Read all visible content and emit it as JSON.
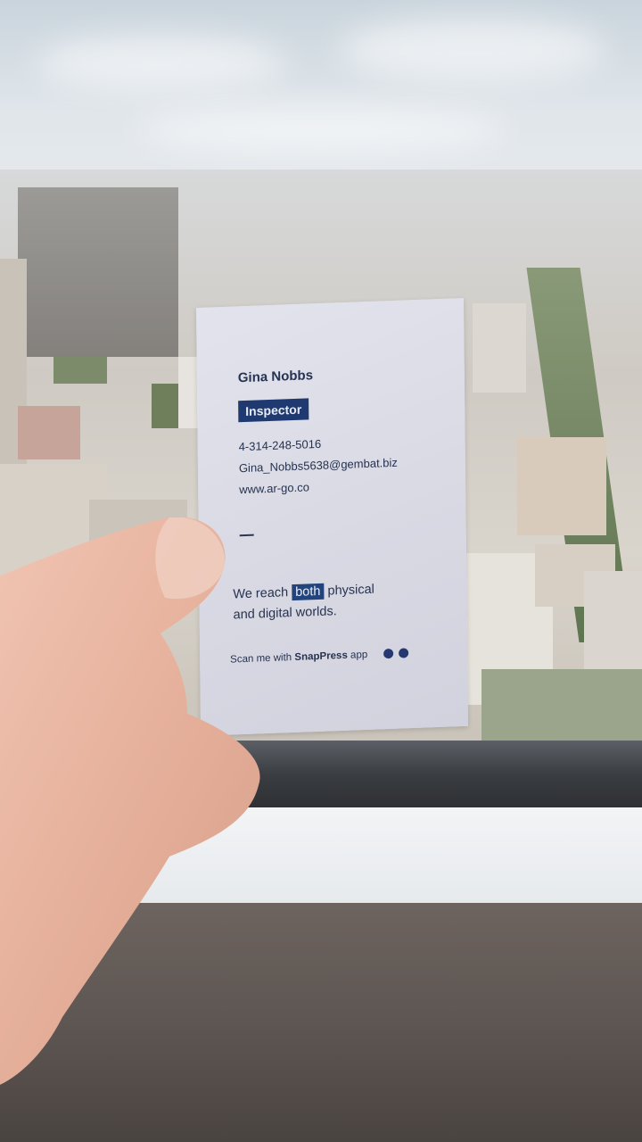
{
  "card": {
    "name": "Gina Nobbs",
    "role": "Inspector",
    "phone": "4-314-248-5016",
    "email": "Gina_Nobbs5638@gembat.biz",
    "website": "www.ar-go.co",
    "tagline_part1": "We reach",
    "tagline_highlight": "both",
    "tagline_part2": "physical",
    "tagline_line2": "and digital worlds.",
    "scan_prefix": "Scan me with",
    "scan_app": "SnapPress",
    "scan_suffix": "app",
    "accent_color": "#1f3a70"
  },
  "icons": [
    "android-icon",
    "apple-icon"
  ]
}
